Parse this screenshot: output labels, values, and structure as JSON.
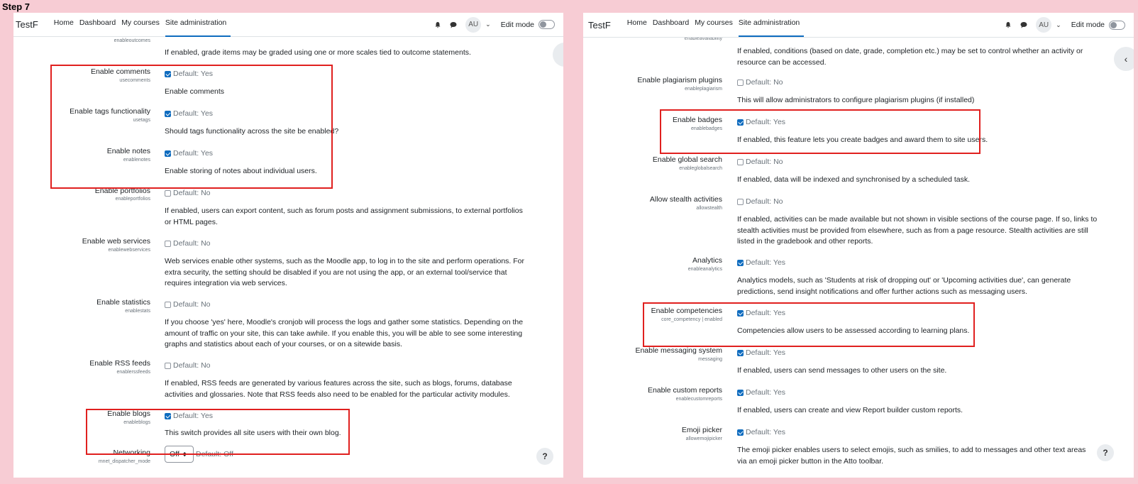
{
  "step": "Step 7",
  "navbar": {
    "brand": "TestF",
    "links": [
      "Home",
      "Dashboard",
      "My courses",
      "Site administration"
    ],
    "avatar": "AU",
    "edit_mode": "Edit mode"
  },
  "left": {
    "top_key": "enableoutcomes",
    "top_desc": "If enabled, grade items may be graded using one or more scales tied to outcome statements.",
    "settings": [
      {
        "title": "Enable comments",
        "key": "usecomments",
        "checked": true,
        "default": "Default: Yes",
        "desc": "Enable comments"
      },
      {
        "title": "Enable tags functionality",
        "key": "usetags",
        "checked": true,
        "default": "Default: Yes",
        "desc": "Should tags functionality across the site be enabled?"
      },
      {
        "title": "Enable notes",
        "key": "enablenotes",
        "checked": true,
        "default": "Default: Yes",
        "desc": "Enable storing of notes about individual users."
      },
      {
        "title": "Enable portfolios",
        "key": "enableportfolios",
        "checked": false,
        "default": "Default: No",
        "desc": "If enabled, users can export content, such as forum posts and assignment submissions, to external portfolios or HTML pages."
      },
      {
        "title": "Enable web services",
        "key": "enablewebservices",
        "checked": false,
        "default": "Default: No",
        "desc": "Web services enable other systems, such as the Moodle app, to log in to the site and perform operations. For extra security, the setting should be disabled if you are not using the app, or an external tool/service that requires integration via web services."
      },
      {
        "title": "Enable statistics",
        "key": "enablestats",
        "checked": false,
        "default": "Default: No",
        "desc": "If you choose 'yes' here, Moodle's cronjob will process the logs and gather some statistics. Depending on the amount of traffic on your site, this can take awhile. If you enable this, you will be able to see some interesting graphs and statistics about each of your courses, or on a sitewide basis."
      },
      {
        "title": "Enable RSS feeds",
        "key": "enablerssfeeds",
        "checked": false,
        "default": "Default: No",
        "desc": "If enabled, RSS feeds are generated by various features across the site, such as blogs, forums, database activities and glossaries. Note that RSS feeds also need to be enabled for the particular activity modules."
      },
      {
        "title": "Enable blogs",
        "key": "enableblogs",
        "checked": true,
        "default": "Default: Yes",
        "desc": "This switch provides all site users with their own blog."
      }
    ],
    "networking": {
      "title": "Networking",
      "key": "mnet_dispatcher_mode",
      "value": "Off",
      "default": "Default: Off"
    }
  },
  "right": {
    "top_key": "enableavailability",
    "top_desc": "If enabled, conditions (based on date, grade, completion etc.) may be set to control whether an activity or resource can be accessed.",
    "settings": [
      {
        "title": "Enable plagiarism plugins",
        "key": "enableplagiarism",
        "checked": false,
        "default": "Default: No",
        "desc": "This will allow administrators to configure plagiarism plugins (if installed)"
      },
      {
        "title": "Enable badges",
        "key": "enablebadges",
        "checked": true,
        "default": "Default: Yes",
        "desc": "If enabled, this feature lets you create badges and award them to site users."
      },
      {
        "title": "Enable global search",
        "key": "enableglobalsearch",
        "checked": false,
        "default": "Default: No",
        "desc": "If enabled, data will be indexed and synchronised by a scheduled task."
      },
      {
        "title": "Allow stealth activities",
        "key": "allowstealth",
        "checked": false,
        "default": "Default: No",
        "desc": "If enabled, activities can be made available but not shown in visible sections of the course page. If so, links to stealth activities must be provided from elsewhere, such as from a page resource. Stealth activities are still listed in the gradebook and other reports."
      },
      {
        "title": "Analytics",
        "key": "enableanalytics",
        "checked": true,
        "default": "Default: Yes",
        "desc": "Analytics models, such as 'Students at risk of dropping out' or 'Upcoming activities due', can generate predictions, send insight notifications and offer further actions such as messaging users."
      },
      {
        "title": "Enable competencies",
        "key": "core_competency | enabled",
        "checked": true,
        "default": "Default: Yes",
        "desc": "Competencies allow users to be assessed according to learning plans."
      },
      {
        "title": "Enable messaging system",
        "key": "messaging",
        "checked": true,
        "default": "Default: Yes",
        "desc": "If enabled, users can send messages to other users on the site."
      },
      {
        "title": "Enable custom reports",
        "key": "enablecustomreports",
        "checked": true,
        "default": "Default: Yes",
        "desc": "If enabled, users can create and view Report builder custom reports."
      },
      {
        "title": "Emoji picker",
        "key": "allowemojipicker",
        "checked": true,
        "default": "Default: Yes",
        "desc": "The emoji picker enables users to select emojis, such as smilies, to add to messages and other text areas via an emoji picker button in the Atto toolbar."
      }
    ]
  },
  "help_label": "?"
}
